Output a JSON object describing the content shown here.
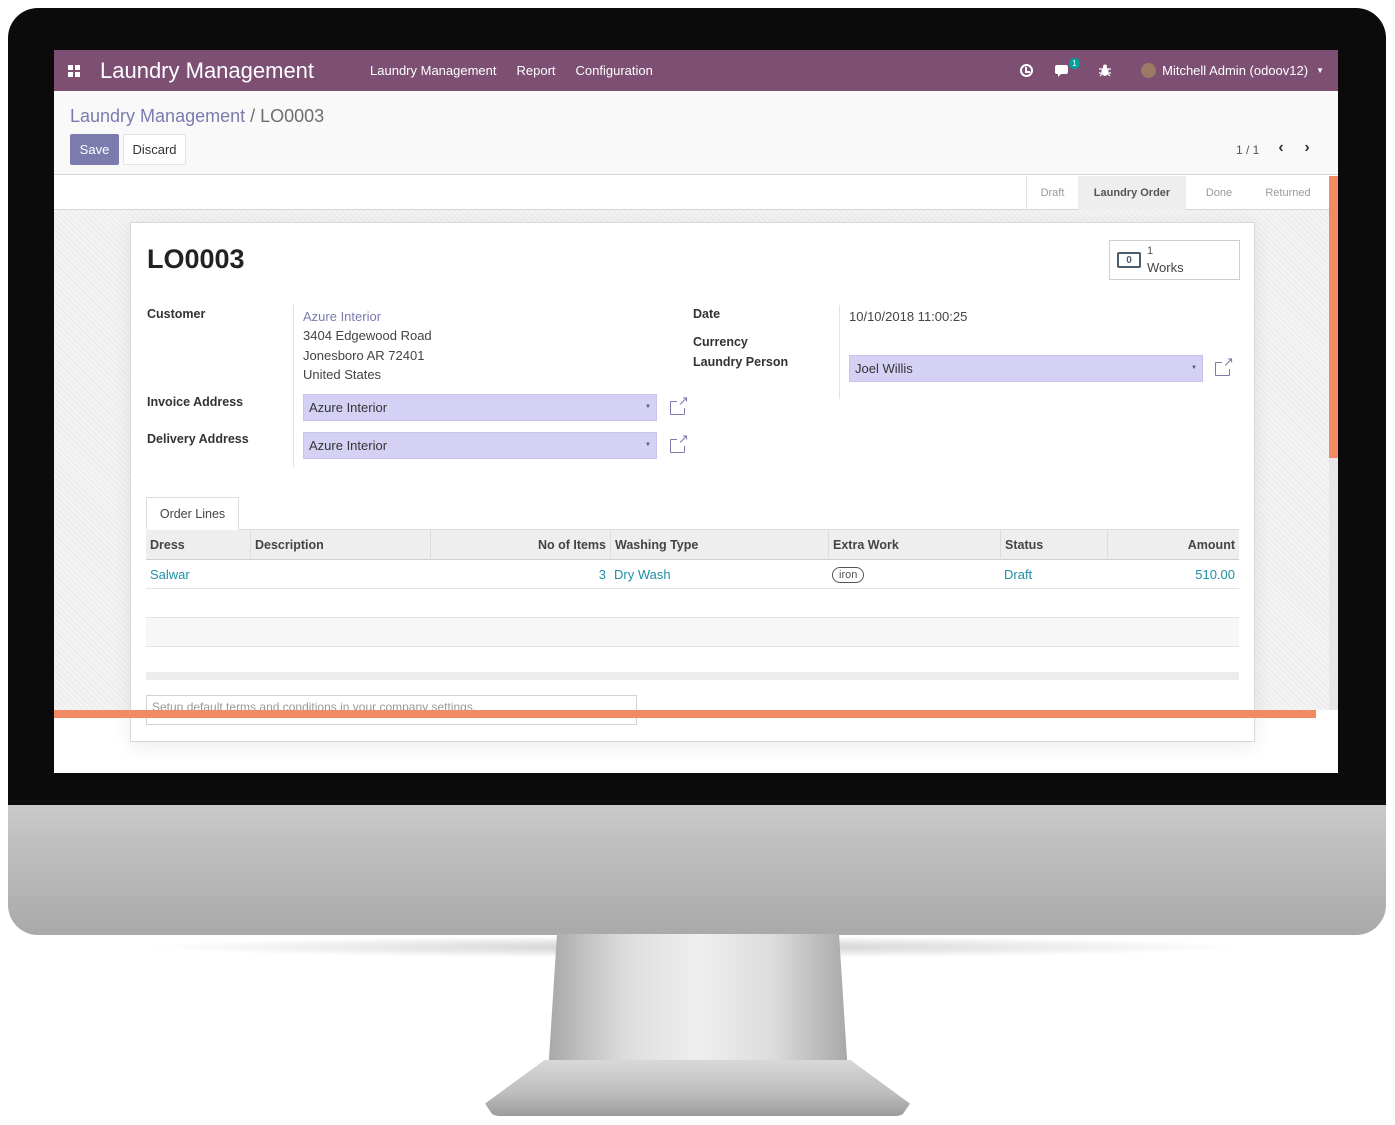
{
  "navbar": {
    "app_title": "Laundry Management",
    "menus": [
      "Laundry Management",
      "Report",
      "Configuration"
    ],
    "chat_badge": "1",
    "user": "Mitchell Admin (odoov12)",
    "color": "#7c4f73"
  },
  "breadcrumb": {
    "parent": "Laundry Management",
    "separator": " / ",
    "current": "LO0003"
  },
  "buttons": {
    "save": "Save",
    "discard": "Discard"
  },
  "pager": {
    "value": "1 / 1",
    "prev": "‹",
    "next": "›"
  },
  "stages": [
    "Draft",
    "Laundry Order",
    "Done",
    "Returned"
  ],
  "active_stage": "Laundry Order",
  "record": {
    "name": "LO0003",
    "works_count": "1",
    "works_label": "Works",
    "works_icon_glyph": "0",
    "customer_label": "Customer",
    "customer_name": "Azure Interior",
    "customer_address": [
      "3404 Edgewood Road",
      "Jonesboro AR 72401",
      "United States"
    ],
    "invoice_label": "Invoice Address",
    "invoice_value": "Azure Interior",
    "delivery_label": "Delivery Address",
    "delivery_value": "Azure Interior",
    "date_label": "Date",
    "date_value": "10/10/2018 11:00:25",
    "currency_label": "Currency",
    "currency_value": "",
    "laundry_person_label": "Laundry Person",
    "laundry_person_value": "Joel Willis"
  },
  "tabs": [
    "Order Lines"
  ],
  "table": {
    "columns": [
      "Dress",
      "Description",
      "No of Items",
      "Washing Type",
      "Extra Work",
      "Status",
      "Amount"
    ],
    "rows": [
      {
        "dress": "Salwar",
        "description": "",
        "items": "3",
        "washing_type": "Dry Wash",
        "extra_work": "iron",
        "status": "Draft",
        "amount": "510.00"
      }
    ]
  },
  "terms_placeholder": "Setup default terms and conditions in your company settings.",
  "colors": {
    "primary": "#7c7bad",
    "accent": "#f28a63",
    "link": "#1f8fa6",
    "field": "#d4d1f5"
  }
}
